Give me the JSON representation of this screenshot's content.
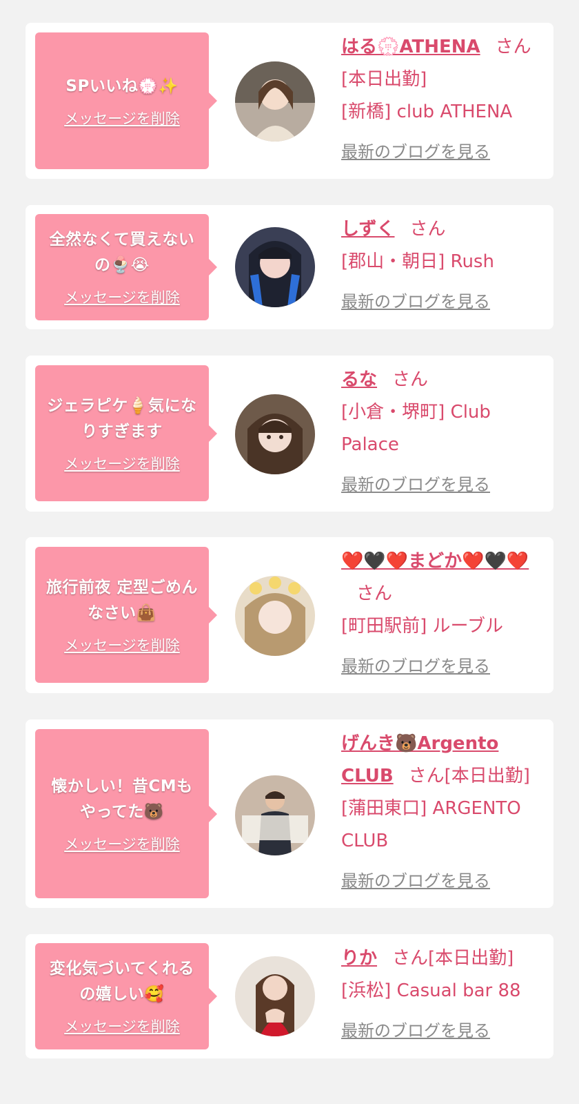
{
  "items": [
    {
      "message": "SPいいね💮✨",
      "delete_label": "メッセージを削除",
      "name": "はる💮ATHENA",
      "san": "さん[本日出勤]",
      "store": "[新橋] club ATHENA",
      "blog_label": "最新のブログを見る"
    },
    {
      "message": "全然なくて買えないの🍨😭",
      "delete_label": "メッセージを削除",
      "name": "しずく",
      "san": "さん",
      "store": "[郡山・朝日] Rush",
      "blog_label": "最新のブログを見る"
    },
    {
      "message": "ジェラピケ🍦気になりすぎます",
      "delete_label": "メッセージを削除",
      "name": "るな",
      "san": "さん",
      "store": "[小倉・堺町] Club Palace",
      "blog_label": "最新のブログを見る"
    },
    {
      "message": "旅行前夜 定型ごめんなさい👜",
      "delete_label": "メッセージを削除",
      "name": "❤️🖤❤️まどか❤️🖤❤️",
      "san": "さん",
      "store": "[町田駅前] ルーブル",
      "blog_label": "最新のブログを見る"
    },
    {
      "message": "懐かしい！昔CMもやってた🐻",
      "delete_label": "メッセージを削除",
      "name": "げんき🐻Argento CLUB",
      "san": "さん[本日出勤]",
      "store": "[蒲田東口] ARGENTO CLUB",
      "blog_label": "最新のブログを見る"
    },
    {
      "message": "変化気づいてくれるの嬉しい🥰",
      "delete_label": "メッセージを削除",
      "name": "りか",
      "san": "さん[本日出勤]",
      "store": "[浜松] Casual bar 88",
      "blog_label": "最新のブログを見る"
    }
  ],
  "colors": {
    "bubble": "#fc97a9",
    "name": "#d94a6c",
    "link_gray": "#8a8a8a",
    "background": "#f2f2f2"
  }
}
